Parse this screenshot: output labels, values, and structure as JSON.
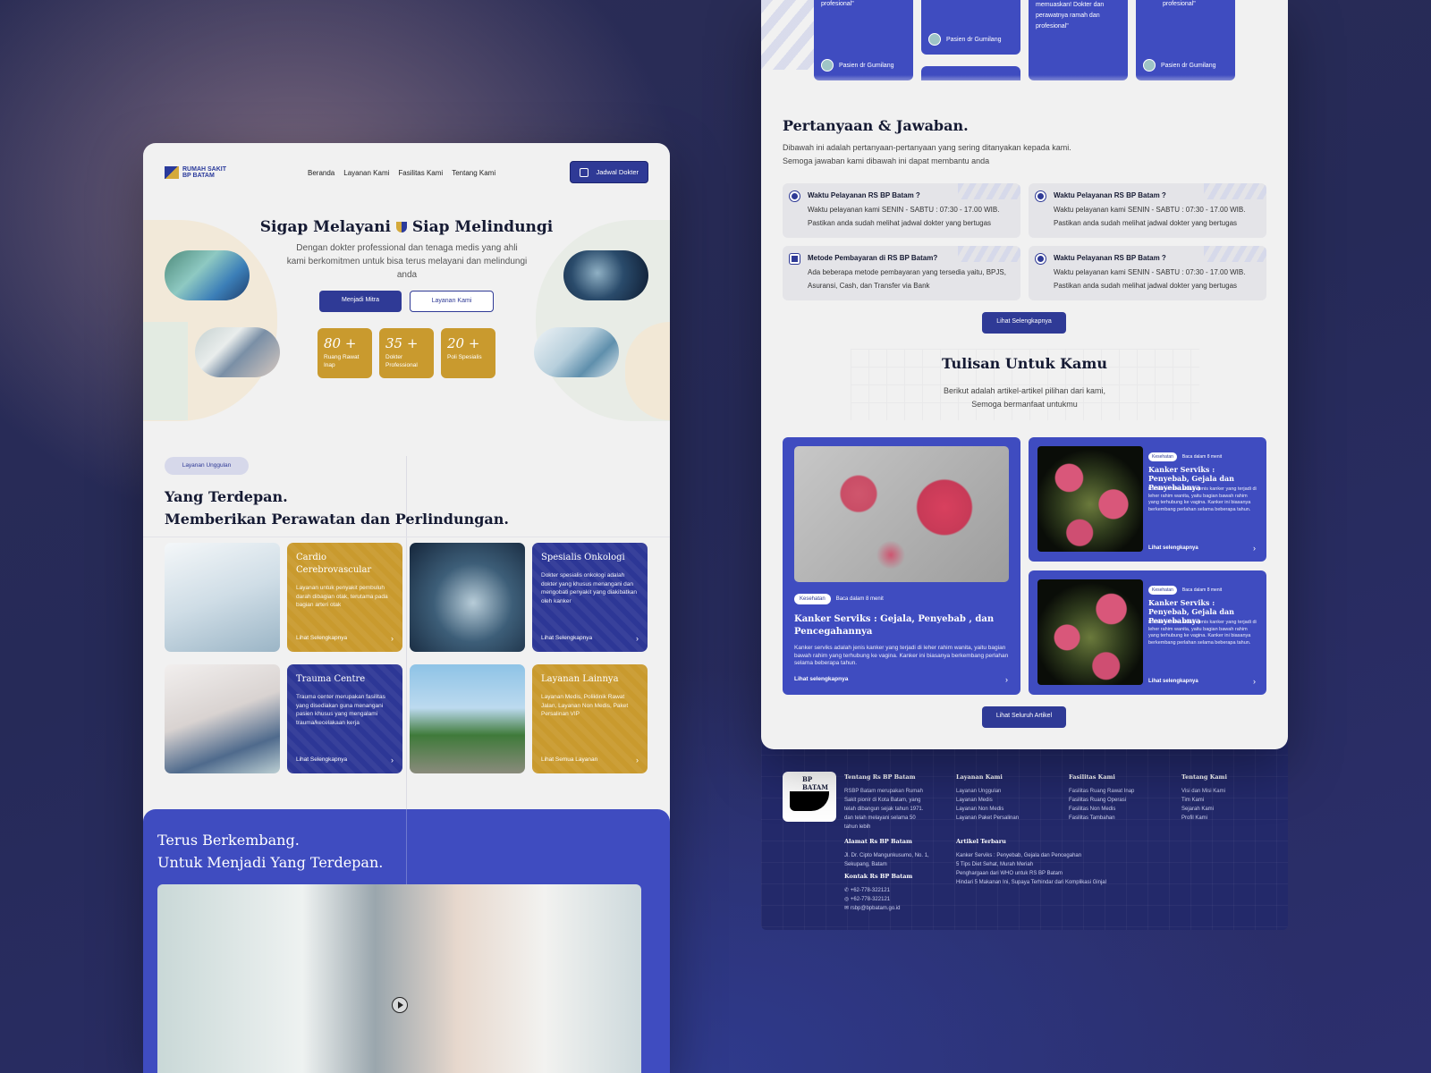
{
  "left": {
    "logo_text": "RUMAH SAKIT BP BATAM",
    "nav": [
      "Beranda",
      "Layanan Kami",
      "Fasilitas Kami",
      "Tentang Kami"
    ],
    "nav_button": "Jadwal Dokter",
    "hero_title_a": "Sigap Melayani",
    "hero_title_b": "Siap Melindungi",
    "hero_subtitle": "Dengan dokter professional dan tenaga medis yang ahli kami berkomitmen untuk bisa terus melayani dan melindungi anda",
    "btn_primary": "Menjadi Mitra",
    "btn_outline": "Layanan Kami",
    "stats": [
      {
        "num": "80 +",
        "label": "Ruang Rawat Inap"
      },
      {
        "num": "35 +",
        "label": "Dokter Professional"
      },
      {
        "num": "20 +",
        "label": "Poli Spesialis"
      }
    ],
    "chip": "Layanan Unggulan",
    "section_title_1": "Yang Terdepan.",
    "section_title_2": "Memberikan Perawatan dan Perlindungan.",
    "cards": {
      "cardio": {
        "title": "Cardio Cerebrovascular",
        "desc": "Layanan untuk penyakit pembuluh darah dibagian otak, terutama pada bagian arteri otak",
        "more": "Lihat Selengkapnya"
      },
      "onko": {
        "title": "Spesialis Onkologi",
        "desc": "Dokter spesialis onkologi adalah dokter yang khusus menangani dan mengobati penyakit yang diakibatkan oleh kanker",
        "more": "Lihat Selengkapnya"
      },
      "trauma": {
        "title": "Trauma Centre",
        "desc": "Trauma center merupakan fasilitas yang disediakan guna menangani pasien khusus yang mengalami trauma/kecelakaan kerja",
        "more": "Lihat Selengkapnya"
      },
      "lain": {
        "title": "Layanan Lainnya",
        "desc": "Layanan Medis, Poliklinik Rawat Jalan, Layanan Non Medis, Paket Persalinan VIP",
        "more": "Lihat Semua Layanan"
      }
    },
    "bottom_title_1": "Terus Berkembang.",
    "bottom_title_2": "Untuk Menjadi Yang Terdepan."
  },
  "right": {
    "testimonials": [
      {
        "text": "profesional\"",
        "who": "Pasien dr Gumilang"
      },
      {
        "text": "",
        "who": "Pasien dr Gumilang"
      },
      {
        "text": "memuaskan! Dokter dan perawatnya ramah dan profesional\"",
        "who": ""
      },
      {
        "text": "profesional\"",
        "who": "Pasien dr Gumilang"
      }
    ],
    "faq_title": "Pertanyaan & Jawaban.",
    "faq_sub_1": "Dibawah ini adalah pertanyaan-pertanyaan yang sering ditanyakan kepada kami.",
    "faq_sub_2": "Semoga jawaban kami dibawah ini dapat membantu anda",
    "faqs": [
      {
        "q": "Waktu Pelayanan RS BP Batam ?",
        "a": "Waktu pelayanan kami SENIN - SABTU : 07:30 - 17.00 WIB. Pastikan anda sudah melihat jadwal dokter yang bertugas"
      },
      {
        "q": "Waktu Pelayanan RS BP Batam ?",
        "a": "Waktu pelayanan kami SENIN - SABTU : 07:30 - 17.00 WIB. Pastikan anda sudah melihat jadwal dokter yang bertugas"
      },
      {
        "q": "Metode Pembayaran di RS BP Batam?",
        "a": "Ada beberapa metode pembayaran yang tersedia yaitu, BPJS, Asuransi, Cash, dan Transfer via Bank"
      },
      {
        "q": "Waktu Pelayanan RS BP Batam ?",
        "a": "Waktu pelayanan kami SENIN - SABTU : 07:30 - 17.00 WIB. Pastikan anda sudah melihat jadwal dokter yang bertugas"
      }
    ],
    "faq_button": "Lihat Selengkapnya",
    "articles_title": "Tulisan Untuk Kamu",
    "articles_sub_1": "Berikut adalah artikel-artikel pilihan dari kami,",
    "articles_sub_2": "Semoga bermanfaat untukmu",
    "article_big": {
      "tag": "Kesehatan",
      "meta": "Baca dalam 8 menit",
      "title": "Kanker Serviks : Gejala, Penyebab , dan Pencegahannya",
      "desc": "Kanker serviks adalah jenis kanker yang terjadi di leher rahim wanita, yaitu bagian bawah rahim yang terhubung ke vagina. Kanker ini biasanya berkembang perlahan selama beberapa tahun.",
      "more": "Lihat selengkapnya"
    },
    "article_small": {
      "tag": "Kesehatan",
      "meta": "Baca dalam 8 menit",
      "title": "Kanker Serviks : Penyebab, Gejala dan Penyebabnya",
      "desc": "Kanker serviks adalah jenis kanker yang terjadi di leher rahim wanita, yaitu bagian bawah rahim yang terhubung ke vagina. Kanker ini biasanya berkembang perlahan selama beberapa tahun.",
      "more": "Lihat selengkapnya"
    },
    "articles_button": "Lihat Seluruh Artikel",
    "footer": {
      "logo_text": "BP BATAM",
      "about_title": "Tentang Rs BP Batam",
      "about_text": "RSBP Batam merupakan Rumah Sakit pionir di Kota Batam, yang telah dibangun sejak tahun 1971. dan telah melayani selama 50 tahun lebih",
      "address_title": "Alamat Rs BP Batam",
      "address_text": "Jl. Dr. Cipto Mangunkusumo, No. 1, Sekupang, Batam",
      "contact_title": "Kontak Rs BP Batam",
      "phone1": "+62-778-322121",
      "phone2": "+62-778-322121",
      "email": "rsbp@bpbatam.go.id",
      "col_layanan_title": "Layanan Kami",
      "col_layanan": [
        "Layanan Unggulan",
        "Layanan Medis",
        "Layanan Non Medis",
        "Layanan Paket Persalinan"
      ],
      "col_fasilitas_title": "Fasilitas Kami",
      "col_fasilitas": [
        "Fasilitas Ruang Rawat Inap",
        "Fasilitas Ruang Operasi",
        "Fasilitas Non Medis",
        "Fasilitas Tambahan"
      ],
      "col_tentang_title": "Tentang Kami",
      "col_tentang": [
        "Visi dan Misi Kami",
        "Tim Kami",
        "Sejarah Kami",
        "Profil Kami"
      ],
      "artikel_title": "Artikel Terbaru",
      "artikel": [
        "Kanker Serviks : Penyebab, Gejala dan Pencegahan",
        "5 Tips Diet Sehat, Murah Meriah",
        "Penghargaan dari WHO untuk RS BP Batam",
        "Hindari 5 Makanan Ini, Supaya Terhindar dari Komplikasi Ginjal"
      ]
    },
    "colors": {
      "primary": "#2f3a96",
      "accent_blue": "#3f4cc0",
      "gold": "#c99a2e",
      "footer": "#23296a"
    }
  }
}
